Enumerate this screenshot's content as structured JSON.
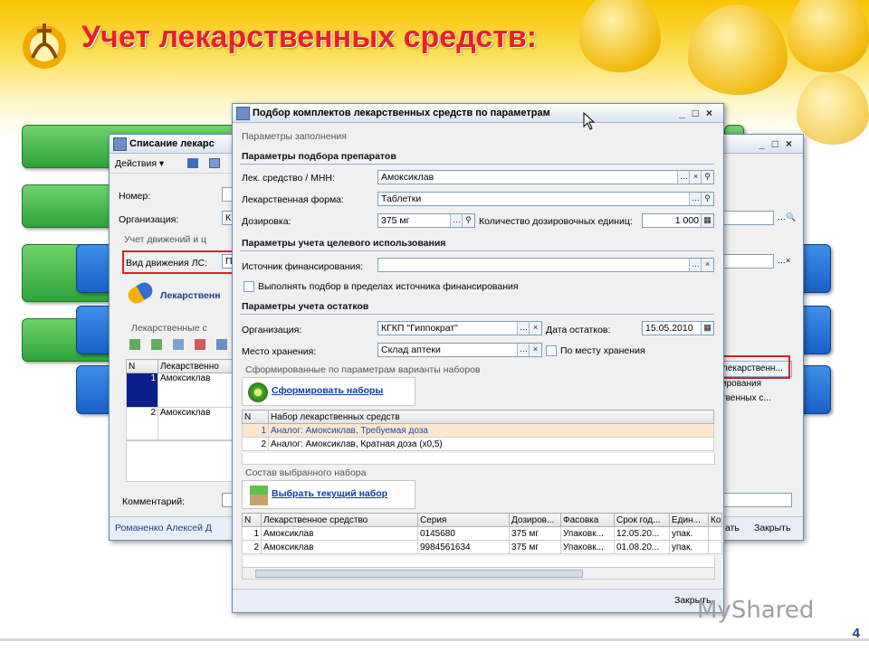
{
  "slide": {
    "title": "Учет лекарственных средств:",
    "page_number": "4",
    "watermark": "MyShared",
    "colors": {
      "title": "#e8202a",
      "banner": "#f7c400",
      "green_button": "#2ea33a",
      "blue_button": "#1960c8"
    }
  },
  "back_window": {
    "title": "Списание лекарс",
    "toolbar": {
      "actions_label": "Действия ▾"
    },
    "number_label": "Номер:",
    "org_label": "Организация:",
    "org_value": "К",
    "movement_group": "Учет движений и ц",
    "movement_label": "Вид движения ЛС:",
    "movement_value": "П",
    "medicine_header": "Лекарственн",
    "medicine_group": "Лекарственные с",
    "table": {
      "headers": [
        "N",
        "Лекарственно"
      ],
      "rows": [
        [
          "1",
          "Амоксиклав"
        ],
        [
          "2",
          "Амоксиклав"
        ]
      ]
    },
    "right_button": "лекарственн...",
    "right_text_1": "ирования",
    "right_text_2": "твенных с...",
    "comment_label": "Комментарий:",
    "author": "Романенко Алексей Д",
    "ok_button": "ать",
    "close_button": "Закрыть"
  },
  "main_window": {
    "title": "Подбор комплектов лекарственных средств по параметрам",
    "params_group": "Параметры заполнения",
    "selection_section": "Параметры подбора препаратов",
    "fields": {
      "drug": {
        "label": "Лек. средство / МНН:",
        "value": "Амоксиклав"
      },
      "form": {
        "label": "Лекарственная форма:",
        "value": "Таблетки"
      },
      "dose": {
        "label": "Дозировка:",
        "value": "375 мг"
      },
      "dose_count": {
        "label": "Количество дозировочных единиц:",
        "value": "1 000"
      }
    },
    "purpose_section": "Параметры учета целевого использования",
    "funding_label": "Источник финансирования:",
    "funding_value": "",
    "funding_checkbox": "Выполнять подбор в пределах источника финансирования",
    "stock_section": "Параметры учета остатков",
    "org_label": "Организация:",
    "org_value": "КГКП \"Гиппократ\"",
    "stock_date_label": "Дата остатков:",
    "stock_date_value": "15.05.2010",
    "storage_label": "Место хранения:",
    "storage_value": "Склад аптеки",
    "storage_checkbox": "По месту хранения",
    "variants_group": "Сформированные по параметрам варианты наборов",
    "form_sets_button": "Сформировать наборы",
    "sets_table": {
      "headers": [
        "N",
        "Набор лекарственных средств"
      ],
      "rows": [
        [
          "1",
          "Аналог: Амоксиклав, Требуемая доза"
        ],
        [
          "2",
          "Аналог: Амоксиклав, Кратная доза (x0,5)"
        ]
      ]
    },
    "composition_group": "Состав выбранного набора",
    "select_set_button": "Выбрать текущий набор",
    "items_table": {
      "headers": [
        "N",
        "Лекарственное средство",
        "Серия",
        "Дозиров...",
        "Фасовка",
        "Срок год...",
        "Един...",
        "Ко"
      ],
      "rows": [
        [
          "1",
          "Амоксиклав",
          "0145680",
          "375 мг",
          "Упаковк...",
          "12.05.20...",
          "упак.",
          ""
        ],
        [
          "2",
          "Амоксиклав",
          "9984561634",
          "375 мг",
          "Упаковк...",
          "01.08.20...",
          "упак.",
          ""
        ]
      ]
    },
    "close_button": "Закрыть"
  }
}
